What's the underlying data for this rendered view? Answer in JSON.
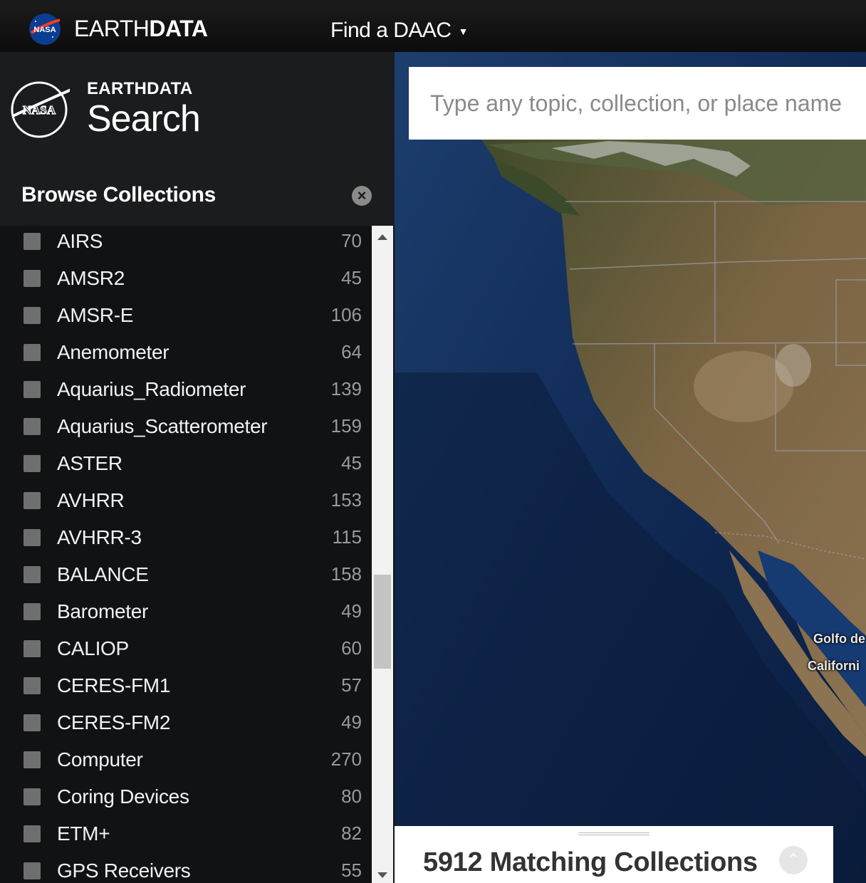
{
  "topbar": {
    "brand_light": "EARTH",
    "brand_bold": "DATA",
    "find_daac": "Find a DAAC"
  },
  "sidebar": {
    "title_small": "EARTHDATA",
    "title_big": "Search",
    "browse_title": "Browse Collections",
    "items": [
      {
        "label": "AIRS",
        "count": "70"
      },
      {
        "label": "AMSR2",
        "count": "45"
      },
      {
        "label": "AMSR-E",
        "count": "106"
      },
      {
        "label": "Anemometer",
        "count": "64"
      },
      {
        "label": "Aquarius_Radiometer",
        "count": "139"
      },
      {
        "label": "Aquarius_Scatterometer",
        "count": "159"
      },
      {
        "label": "ASTER",
        "count": "45"
      },
      {
        "label": "AVHRR",
        "count": "153"
      },
      {
        "label": "AVHRR-3",
        "count": "115"
      },
      {
        "label": "BALANCE",
        "count": "158"
      },
      {
        "label": "Barometer",
        "count": "49"
      },
      {
        "label": "CALIOP",
        "count": "60"
      },
      {
        "label": "CERES-FM1",
        "count": "57"
      },
      {
        "label": "CERES-FM2",
        "count": "49"
      },
      {
        "label": "Computer",
        "count": "270"
      },
      {
        "label": "Coring Devices",
        "count": "80"
      },
      {
        "label": "ETM+",
        "count": "82"
      },
      {
        "label": "GPS Receivers",
        "count": "55"
      }
    ]
  },
  "search": {
    "placeholder": "Type any topic, collection, or place name"
  },
  "map": {
    "labels": [
      "Golfo de",
      "Californi"
    ]
  },
  "results": {
    "title": "5912 Matching Collections"
  },
  "colors": {
    "topbar": "#111111",
    "sidebar": "#1b1c1e",
    "ocean": "#0f2244",
    "land": "#6b5a3c"
  }
}
